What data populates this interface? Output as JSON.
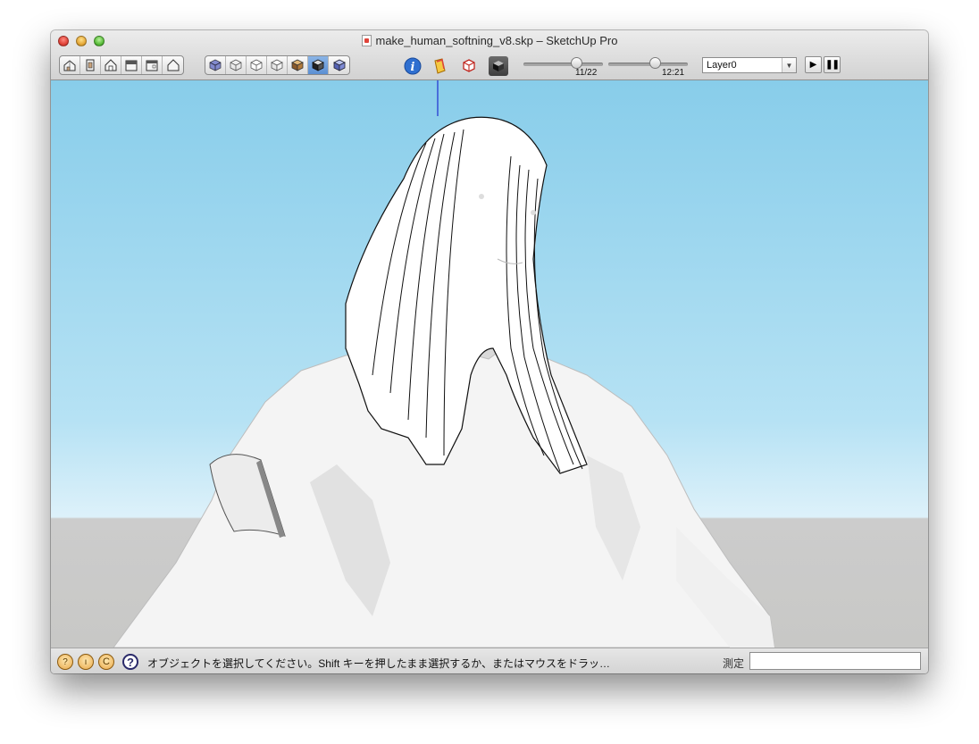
{
  "window": {
    "title": "make_human_softning_v8.skp – SketchUp Pro"
  },
  "toolbar": {
    "views_group": [
      "iso-view",
      "top-view",
      "front-view",
      "right-view",
      "back-view",
      "left-view"
    ],
    "style_group": [
      "xray-style",
      "wireframe-style",
      "hidden-line-style",
      "shaded-style",
      "shaded-texture-style",
      "monochrome-style",
      "shaded-active-style"
    ],
    "date_slider": {
      "value_label": "11/22",
      "fraction": 0.7
    },
    "time_slider": {
      "value_label": "12:21",
      "fraction": 0.6
    },
    "layer_value": "Layer0"
  },
  "status": {
    "message": "オブジェクトを選択してください。Shift キーを押したまま選択するか、またはマウスをドラッ…",
    "measure_label": "測定",
    "measure_value": ""
  },
  "colors": {
    "sky_top": "#88cdea",
    "ground": "#c8c8c6",
    "accent_blue": "#2f6fd0"
  }
}
